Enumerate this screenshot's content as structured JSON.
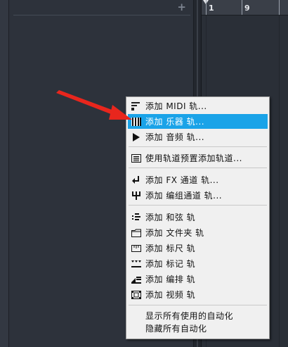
{
  "inspector": {
    "add_label": "+"
  },
  "ruler": {
    "labels": [
      "1",
      "9"
    ]
  },
  "context_menu": {
    "items": [
      {
        "key": "add_midi",
        "label": "添加 MIDI 轨...",
        "icon": "midi-track-icon"
      },
      {
        "key": "add_instrument",
        "label": "添加 乐器 轨...",
        "icon": "instrument-track-icon",
        "highlighted": true
      },
      {
        "key": "add_audio",
        "label": "添加 音频 轨...",
        "icon": "audio-track-icon"
      },
      {
        "key": "preset",
        "label": "使用轨道预置添加轨道...",
        "icon": "preset-track-icon"
      },
      {
        "key": "add_fx",
        "label": "添加 FX 通道 轨...",
        "icon": "fx-channel-icon"
      },
      {
        "key": "add_group",
        "label": "添加 编组通道 轨...",
        "icon": "group-channel-icon"
      },
      {
        "key": "add_chord",
        "label": "添加 和弦 轨",
        "icon": "chord-track-icon"
      },
      {
        "key": "add_folder",
        "label": "添加 文件夹 轨",
        "icon": "folder-icon"
      },
      {
        "key": "add_ruler",
        "label": "添加 标尺 轨",
        "icon": "ruler-track-icon"
      },
      {
        "key": "add_marker",
        "label": "添加 标记 轨",
        "icon": "marker-track-icon"
      },
      {
        "key": "add_arranger",
        "label": "添加 编排 轨",
        "icon": "arranger-track-icon"
      },
      {
        "key": "add_video",
        "label": "添加 视频 轨",
        "icon": "video-track-icon"
      },
      {
        "key": "show_auto",
        "label": "显示所有使用的自动化",
        "icon": ""
      },
      {
        "key": "hide_auto",
        "label": "隐藏所有自动化",
        "icon": ""
      }
    ]
  },
  "colors": {
    "highlight": "#1aa3e8",
    "annotation_arrow": "#e8261d"
  }
}
